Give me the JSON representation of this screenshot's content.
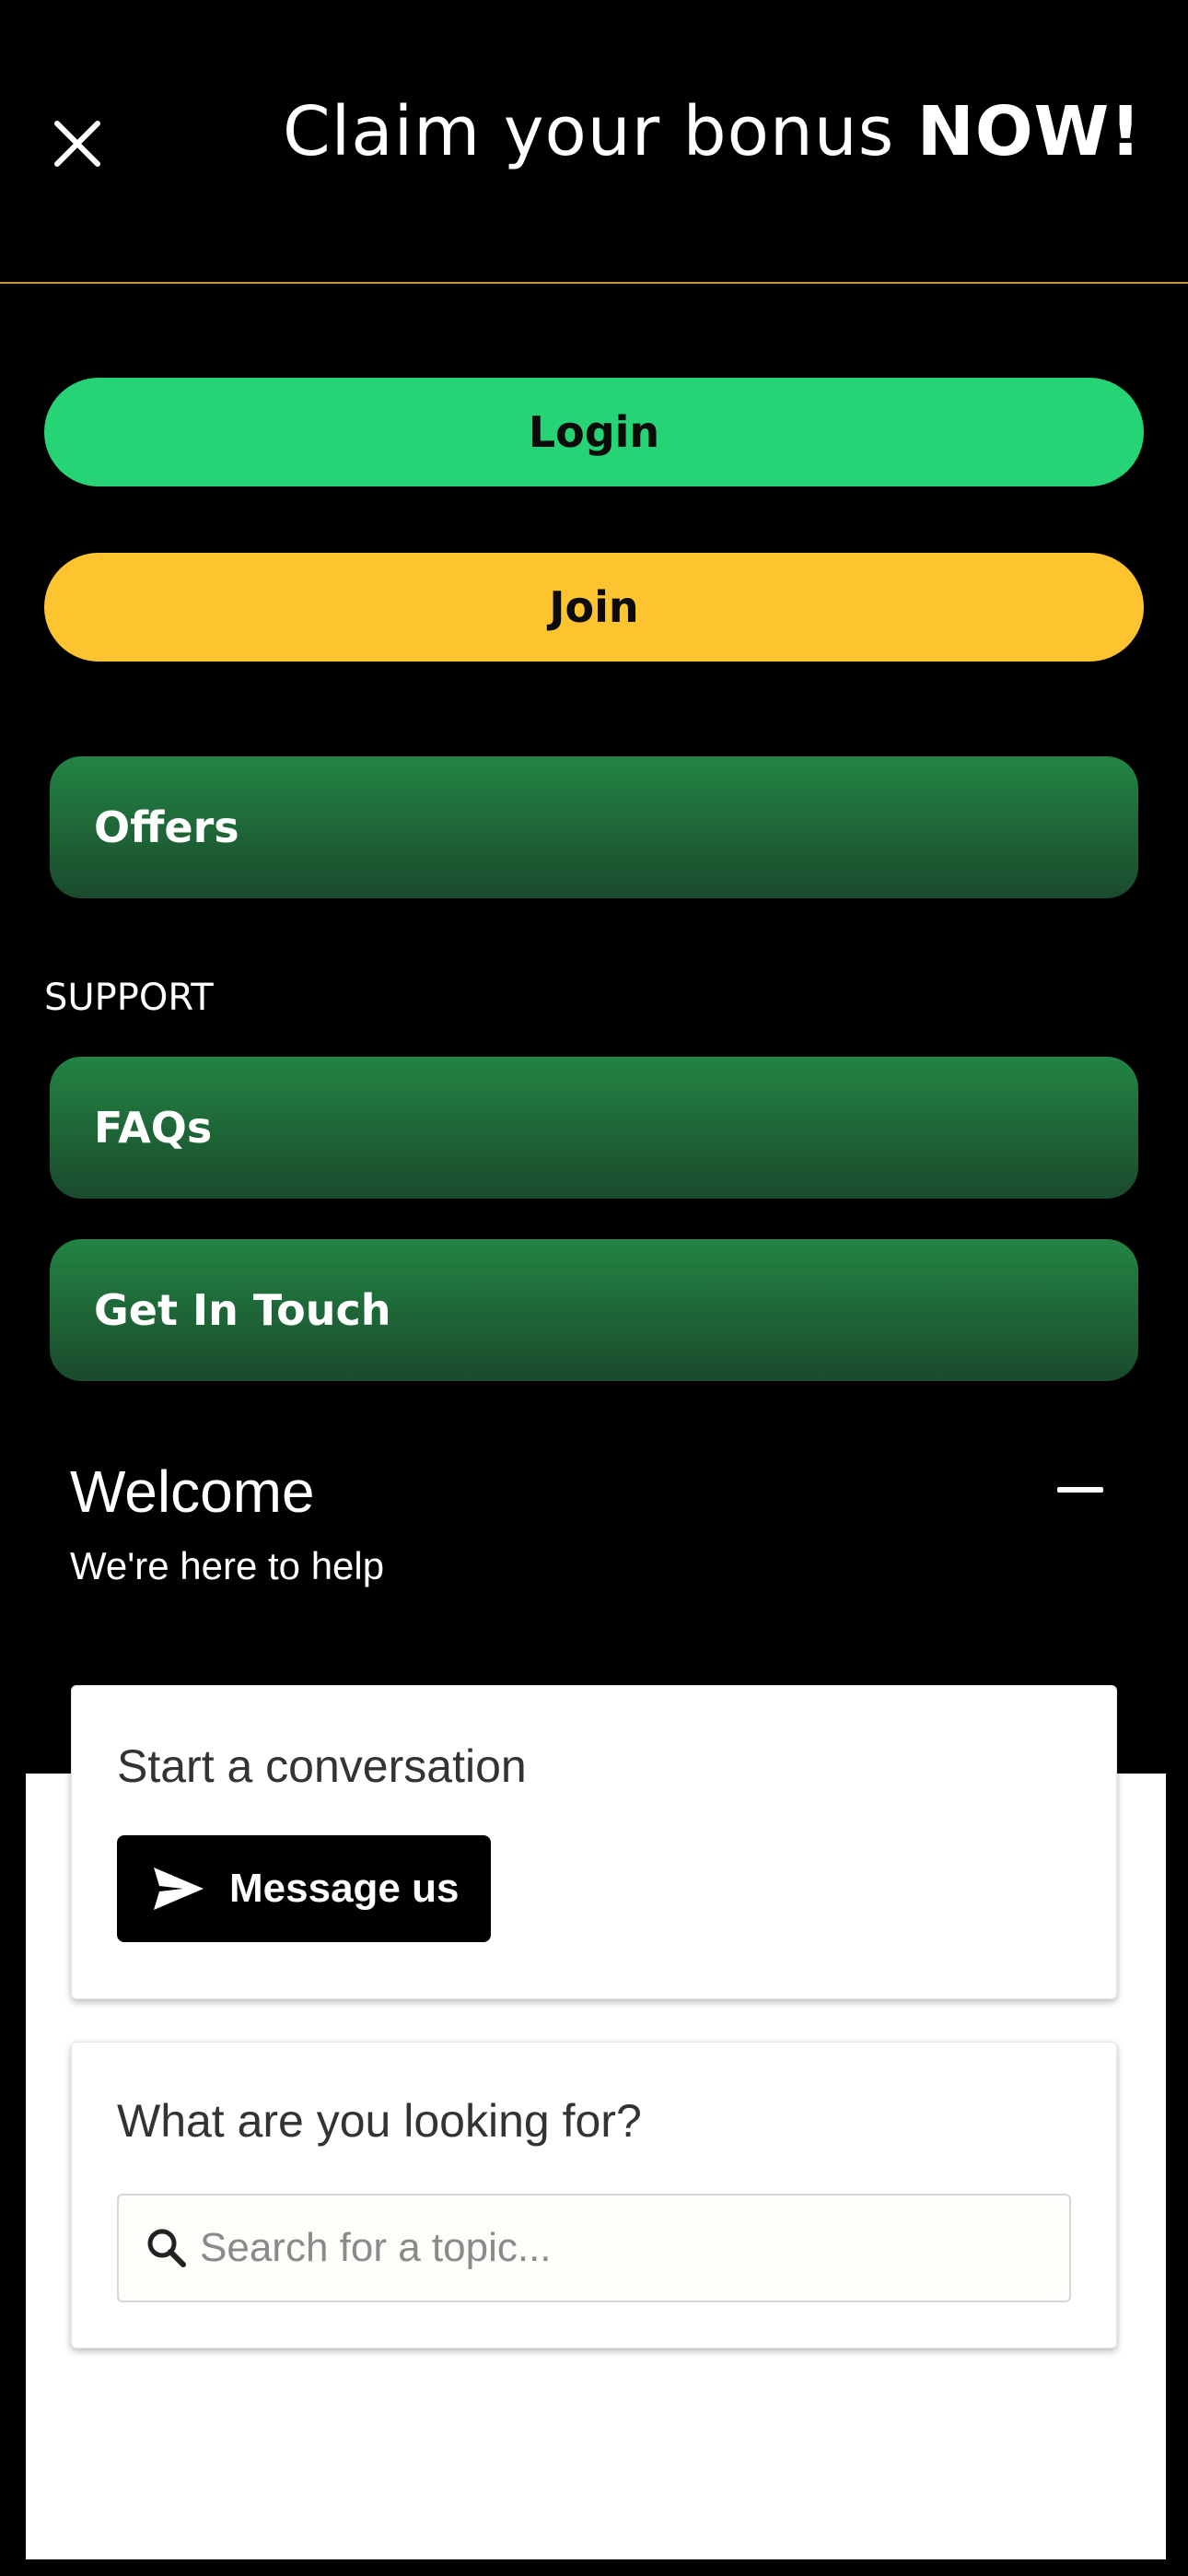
{
  "header": {
    "title_regular": "Claim your bonus ",
    "title_bold": "NOW!",
    "close_icon": "close-icon"
  },
  "auth": {
    "login_label": "Login",
    "join_label": "Join"
  },
  "menu": {
    "offers_label": "Offers",
    "support_section_label": "SUPPORT",
    "faqs_label": "FAQs",
    "get_in_touch_label": "Get In Touch"
  },
  "chat_widget": {
    "welcome_title": "Welcome",
    "welcome_subtitle": "We're here to help",
    "minimize_icon": "minus-icon",
    "conversation_heading": "Start a conversation",
    "message_button_label": "Message us",
    "message_button_icon": "send-icon",
    "search_heading": "What are you looking for?",
    "search_placeholder": "Search for a topic...",
    "search_icon": "search-icon"
  },
  "colors": {
    "background": "#000000",
    "header_divider": "#c8953f",
    "login_button": "#26d475",
    "join_button": "#fdc430",
    "menu_card_top": "#238444",
    "menu_card_bottom": "#1a4a2c",
    "message_button": "#000000"
  }
}
